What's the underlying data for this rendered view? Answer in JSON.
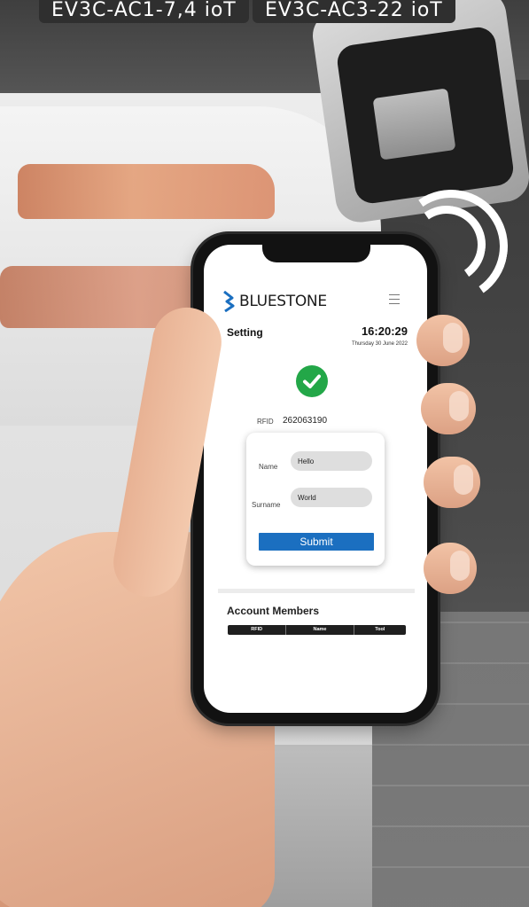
{
  "background": {
    "product_tags": [
      "EV3C-AC1-7,4 ioT",
      "EV3C-AC3-22 ioT"
    ]
  },
  "app": {
    "brand": "BLUESTONE",
    "page_title": "Setting",
    "time": "16:20:29",
    "date": "Thursday 30 June 2022",
    "status_icon": "check-circle",
    "accent_color": "#1b6fc0",
    "success_color": "#23a748"
  },
  "rfid": {
    "label": "RFID",
    "value": "262063190"
  },
  "form": {
    "name_label": "Name",
    "name_value": "Hello",
    "surname_label": "Surname",
    "surname_value": "World",
    "submit_label": "Submit"
  },
  "members": {
    "title": "Account Members",
    "columns": [
      "RFID",
      "Name",
      "Tool"
    ]
  }
}
